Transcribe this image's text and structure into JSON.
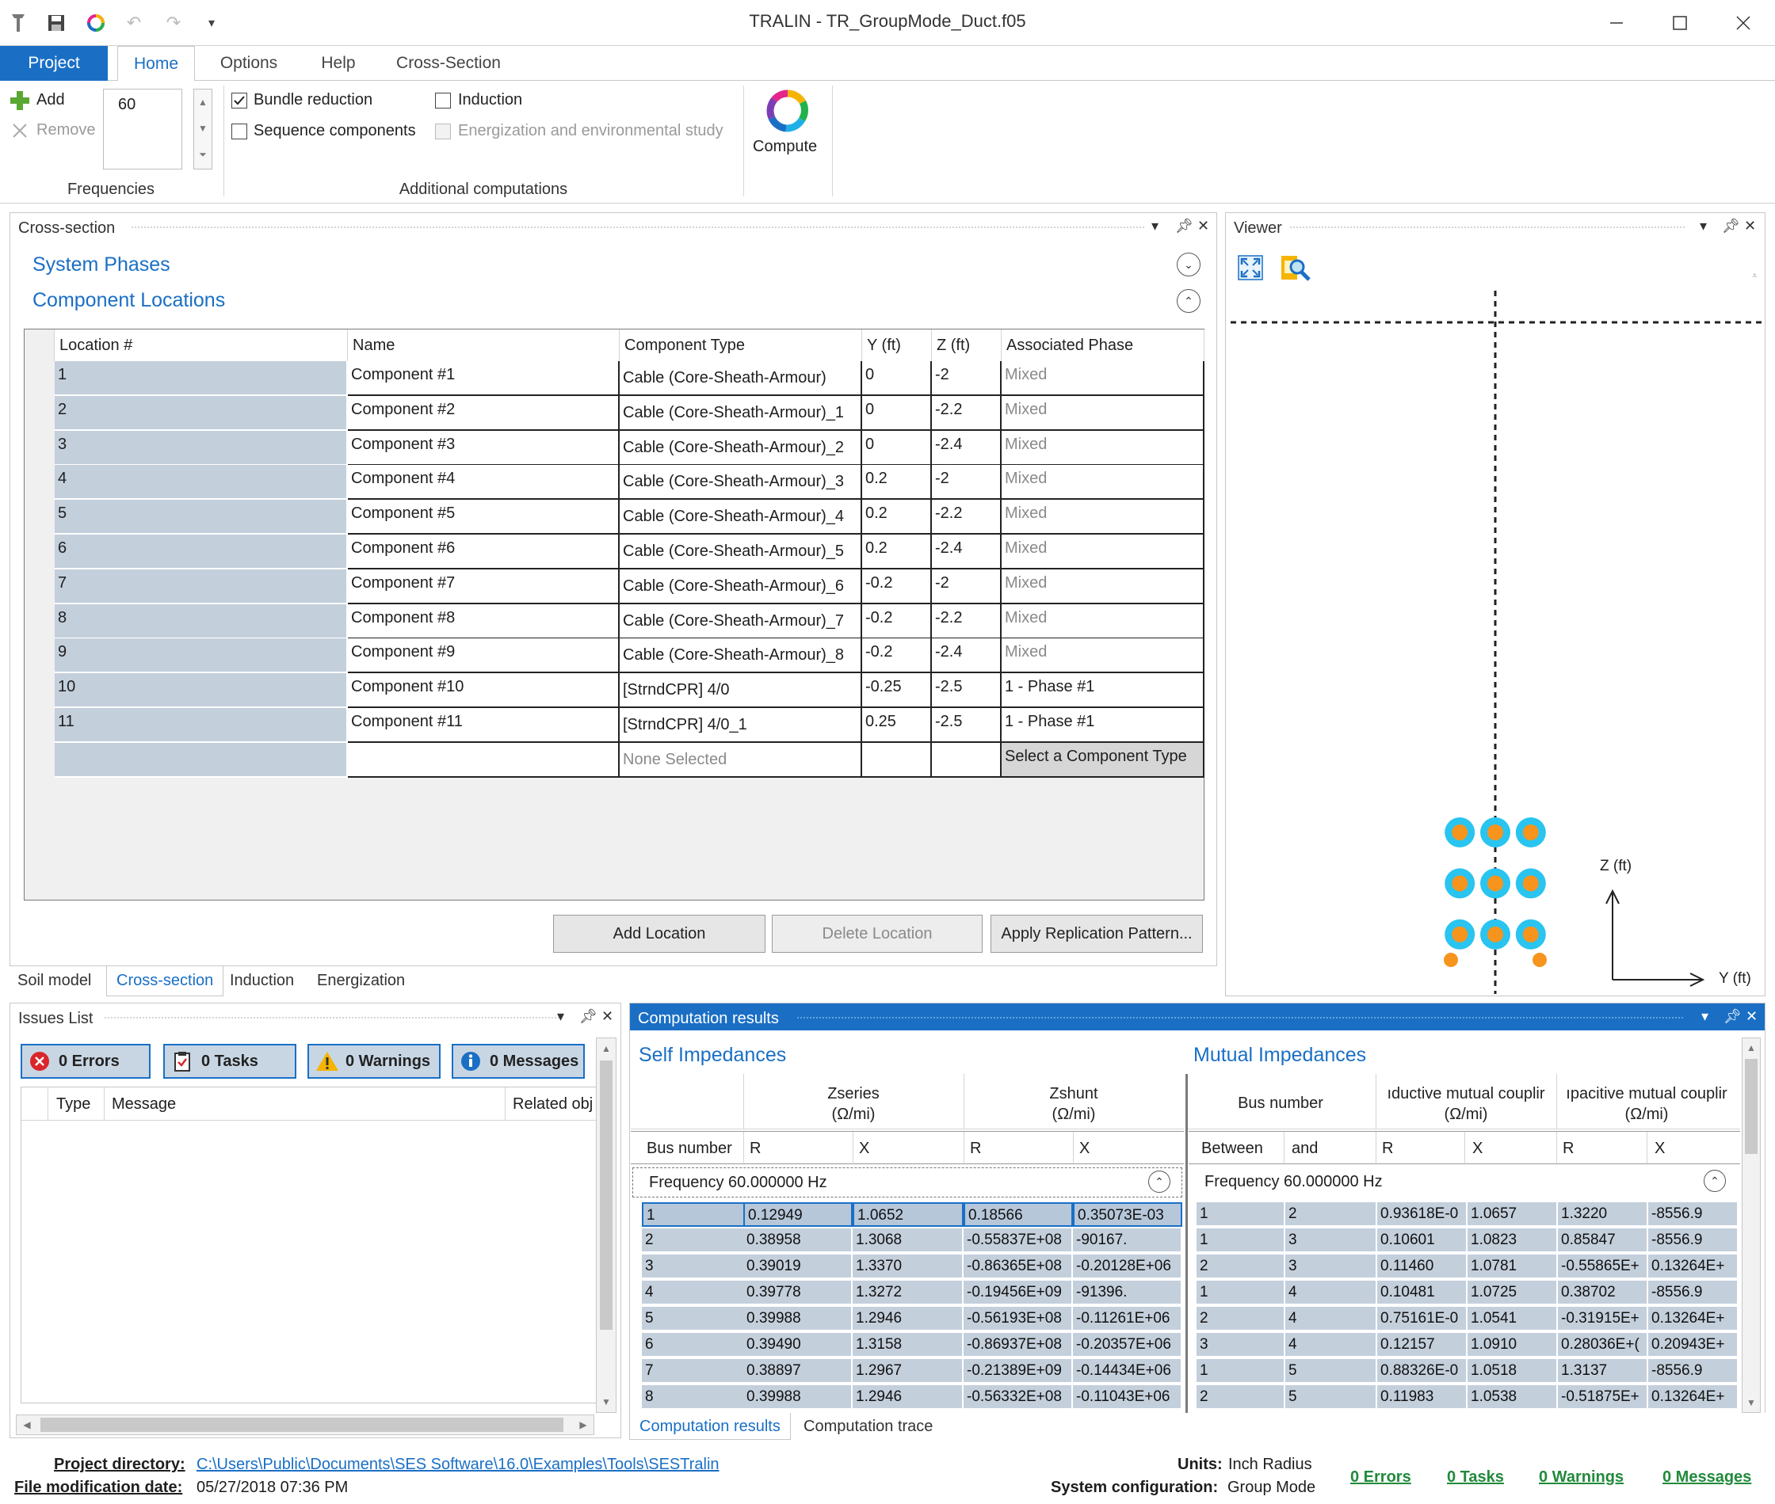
{
  "app": {
    "title": "TRALIN - TR_GroupMode_Duct.f05"
  },
  "quick_access": {
    "icons": [
      "app-icon",
      "save-icon",
      "color-wheel-icon",
      "undo-icon",
      "redo-icon",
      "customize-icon"
    ]
  },
  "ribbon_tabs": [
    "Project",
    "Home",
    "Options",
    "Help",
    "Cross-Section"
  ],
  "ribbon": {
    "add_label": "Add",
    "remove_label": "Remove",
    "frequency_value": "60",
    "frequencies_group": "Frequencies",
    "bundle_reduction": "Bundle reduction",
    "sequence_components": "Sequence components",
    "induction": "Induction",
    "energization": "Energization and environmental study",
    "additional_group": "Additional computations",
    "compute_label": "Compute"
  },
  "cross_section": {
    "panel_title": "Cross-section",
    "system_phases": "System Phases",
    "component_locations": "Component Locations",
    "columns": [
      "Location #",
      "Name",
      "Component Type",
      "Y (ft)",
      "Z (ft)",
      "Associated Phase"
    ],
    "rows": [
      [
        "1",
        "Component #1",
        "Cable (Core-Sheath-Armour)",
        "0",
        "-2",
        "Mixed"
      ],
      [
        "2",
        "Component #2",
        "Cable (Core-Sheath-Armour)_1",
        "0",
        "-2.2",
        "Mixed"
      ],
      [
        "3",
        "Component #3",
        "Cable (Core-Sheath-Armour)_2",
        "0",
        "-2.4",
        "Mixed"
      ],
      [
        "4",
        "Component #4",
        "Cable (Core-Sheath-Armour)_3",
        "0.2",
        "-2",
        "Mixed"
      ],
      [
        "5",
        "Component #5",
        "Cable (Core-Sheath-Armour)_4",
        "0.2",
        "-2.2",
        "Mixed"
      ],
      [
        "6",
        "Component #6",
        "Cable (Core-Sheath-Armour)_5",
        "0.2",
        "-2.4",
        "Mixed"
      ],
      [
        "7",
        "Component #7",
        "Cable (Core-Sheath-Armour)_6",
        "-0.2",
        "-2",
        "Mixed"
      ],
      [
        "8",
        "Component #8",
        "Cable (Core-Sheath-Armour)_7",
        "-0.2",
        "-2.2",
        "Mixed"
      ],
      [
        "9",
        "Component #9",
        "Cable (Core-Sheath-Armour)_8",
        "-0.2",
        "-2.4",
        "Mixed"
      ],
      [
        "10",
        "Component #10",
        "[StrndCPR] 4/0",
        "-0.25",
        "-2.5",
        "1 - Phase #1"
      ],
      [
        "11",
        "Component #11",
        "[StrndCPR] 4/0_1",
        "0.25",
        "-2.5",
        "1 - Phase #1"
      ],
      [
        "",
        "",
        "None Selected",
        "",
        "",
        "Select a Component Type"
      ]
    ],
    "add_location": "Add Location",
    "delete_location": "Delete Location",
    "apply_replication": "Apply Replication Pattern...",
    "bottom_tabs": [
      "Soil model",
      "Cross-section",
      "Induction",
      "Energization"
    ]
  },
  "viewer": {
    "title": "Viewer",
    "z_label": "Z (ft)",
    "y_label": "Y (ft)"
  },
  "issues": {
    "title": "Issues List",
    "errors": "0 Errors",
    "tasks": "0 Tasks",
    "warnings": "0 Warnings",
    "messages": "0 Messages",
    "columns": [
      "Type",
      "Message",
      "Related obj"
    ]
  },
  "results": {
    "title": "Computation results",
    "self_title": "Self Impedances",
    "mutual_title": "Mutual Impedances",
    "zseries": "Zseries",
    "zshunt": "Zshunt",
    "ohm_mi": "(Ω/mi)",
    "bus_number": "Bus number",
    "ind_coupling": "ıductive mutual couplir",
    "cap_coupling": "ıpacitive mutual couplir",
    "sub_r": "R",
    "sub_x": "X",
    "between": "Between",
    "and": "and",
    "frequency": "Frequency 60.000000 Hz",
    "self_rows": [
      [
        "1",
        "0.12949",
        "1.0652",
        "0.18566",
        "0.35073E-03"
      ],
      [
        "2",
        "0.38958",
        "1.3068",
        "-0.55837E+08",
        "-90167."
      ],
      [
        "3",
        "0.39019",
        "1.3370",
        "-0.86365E+08",
        "-0.20128E+06"
      ],
      [
        "4",
        "0.39778",
        "1.3272",
        "-0.19456E+09",
        "-91396."
      ],
      [
        "5",
        "0.39988",
        "1.2946",
        "-0.56193E+08",
        "-0.11261E+06"
      ],
      [
        "6",
        "0.39490",
        "1.3158",
        "-0.86937E+08",
        "-0.20357E+06"
      ],
      [
        "7",
        "0.38897",
        "1.2967",
        "-0.21389E+09",
        "-0.14434E+06"
      ],
      [
        "8",
        "0.39988",
        "1.2946",
        "-0.56332E+08",
        "-0.11043E+06"
      ]
    ],
    "mutual_rows": [
      [
        "1",
        "2",
        "0.93618E-0",
        "1.0657",
        "1.3220",
        "-8556.9"
      ],
      [
        "1",
        "3",
        "0.10601",
        "1.0823",
        "0.85847",
        "-8556.9"
      ],
      [
        "2",
        "3",
        "0.11460",
        "1.0781",
        "-0.55865E+",
        "0.13264E+"
      ],
      [
        "1",
        "4",
        "0.10481",
        "1.0725",
        "0.38702",
        "-8556.9"
      ],
      [
        "2",
        "4",
        "0.75161E-0",
        "1.0541",
        "-0.31915E+",
        "0.13264E+"
      ],
      [
        "3",
        "4",
        "0.12157",
        "1.0910",
        "0.28036E+(",
        "0.20943E+"
      ],
      [
        "1",
        "5",
        "0.88326E-0",
        "1.0518",
        "1.3137",
        "-8556.9"
      ],
      [
        "2",
        "5",
        "0.11983",
        "1.0538",
        "-0.51875E+",
        "0.13264E+"
      ]
    ],
    "tabs": [
      "Computation results",
      "Computation trace"
    ]
  },
  "status": {
    "project_dir_label": "Project directory:",
    "project_dir": "C:\\Users\\Public\\Documents\\SES Software\\16.0\\Examples\\Tools\\SESTralin",
    "file_mod_label": "File modification date:",
    "file_mod": "05/27/2018 07:36 PM",
    "units_label": "Units:",
    "units": "Inch Radius",
    "sysconf_label": "System configuration:",
    "sysconf": "Group Mode",
    "errors": "0 Errors",
    "tasks": "0 Tasks",
    "warnings": "0 Warnings",
    "messages": "0 Messages"
  },
  "colors": {
    "accent": "#1a6fc5",
    "cell_bg": "#c4cfdc",
    "conductor_outer": "#29c4f0",
    "conductor_inner": "#f7941d"
  }
}
